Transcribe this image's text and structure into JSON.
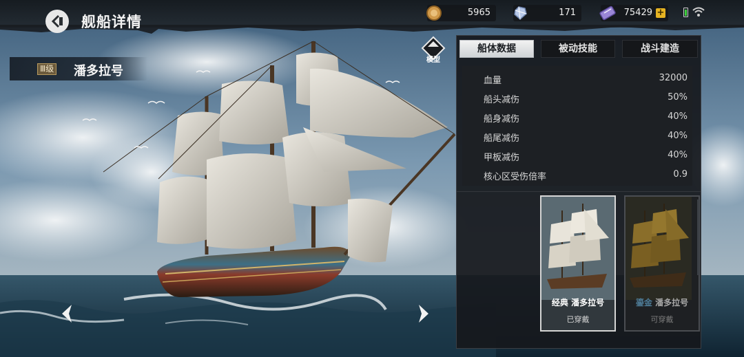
{
  "header": {
    "title": "舰船详情"
  },
  "resources": {
    "coins": "5965",
    "diamonds": "171",
    "tickets": "75429"
  },
  "ship": {
    "tier": "Ⅲ级",
    "name": "潘多拉号"
  },
  "panel": {
    "model_label": "模型",
    "tabs": [
      {
        "label": "船体数据",
        "active": true
      },
      {
        "label": "被动技能",
        "active": false
      },
      {
        "label": "战斗建造",
        "active": false
      }
    ],
    "stats": [
      {
        "label": "血量",
        "value": "32000"
      },
      {
        "label": "船头减伤",
        "value": "50%"
      },
      {
        "label": "船身减伤",
        "value": "40%"
      },
      {
        "label": "船尾减伤",
        "value": "40%"
      },
      {
        "label": "甲板减伤",
        "value": "40%"
      },
      {
        "label": "核心区受伤倍率",
        "value": "0.9"
      }
    ],
    "skins": [
      {
        "prefix": "经典",
        "name": "潘多拉号",
        "status": "已穿戴"
      },
      {
        "prefix": "鎏金",
        "name": "潘多拉号",
        "status": "可穿戴"
      }
    ]
  },
  "colors": {
    "accent_gold": "#e6b322",
    "battery_green": "#3ecf3e",
    "panel_bg": "#16181c"
  }
}
